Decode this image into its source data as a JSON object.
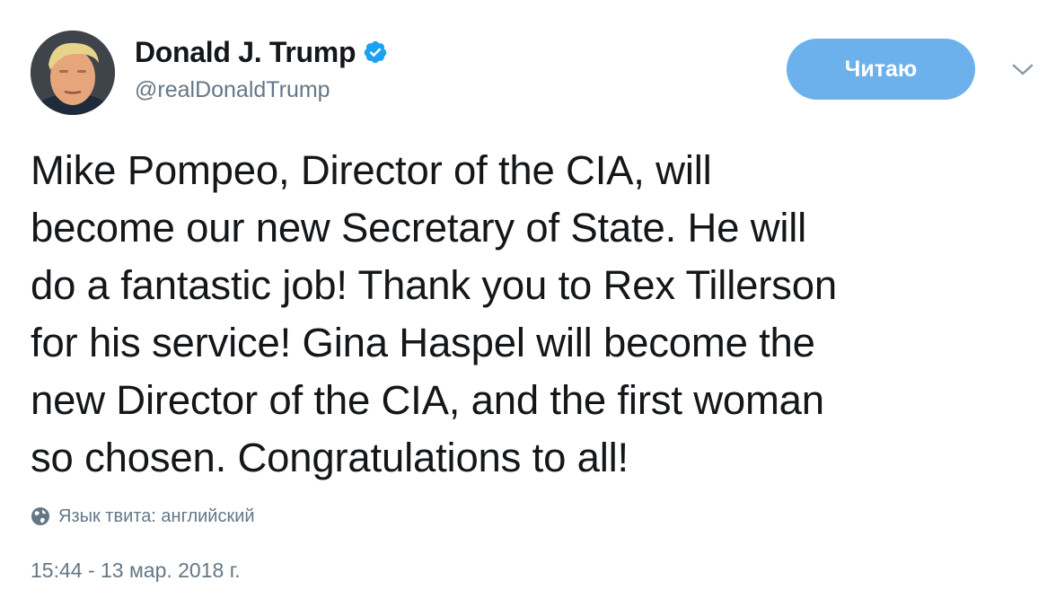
{
  "author": {
    "display_name": "Donald J. Trump",
    "handle": "@realDonaldTrump",
    "verified": true,
    "avatar_icon": "profile-photo"
  },
  "follow_button": {
    "label": "Читаю"
  },
  "menu": {
    "icon": "chevron-down-icon"
  },
  "tweet": {
    "text": "Mike Pompeo, Director of the CIA, will\nbecome our new Secretary of State. He will\ndo a fantastic job! Thank you to Rex Tillerson\nfor his service! Gina Haspel will become the\nnew Director of the CIA, and the first woman\nso chosen. Congratulations to all!",
    "language_label": "Язык твита: английский",
    "timestamp": "15:44 - 13 мар. 2018 г."
  },
  "colors": {
    "accent": "#1da1f2",
    "follow_button_bg": "#6cb1ec",
    "secondary_text": "#657786",
    "primary_text": "#14171a"
  }
}
